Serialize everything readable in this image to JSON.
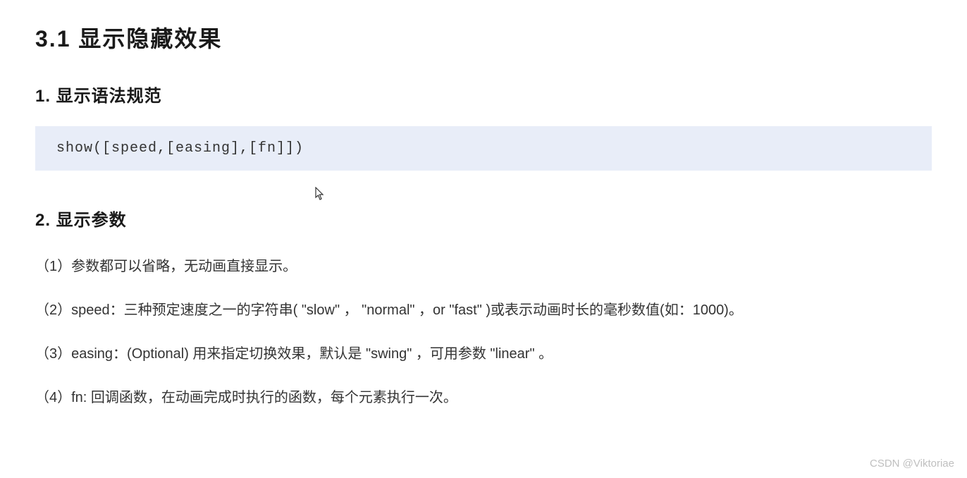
{
  "section": {
    "title": "3.1  显示隐藏效果"
  },
  "sub1": {
    "title": "1. 显示语法规范",
    "code": "show([speed,[easing],[fn]])"
  },
  "sub2": {
    "title": "2. 显示参数",
    "params": [
      "（1）参数都可以省略，无动画直接显示。",
      "（2）speed：三种预定速度之一的字符串( \"slow\" ， \"normal\" ，or  \"fast\" )或表示动画时长的毫秒数值(如：1000)。",
      "（3）easing：(Optional) 用来指定切换效果，默认是 \"swing\" ，可用参数 \"linear\" 。",
      "（4）fn: 回调函数，在动画完成时执行的函数，每个元素执行一次。"
    ]
  },
  "watermark": "CSDN @Viktoriae"
}
